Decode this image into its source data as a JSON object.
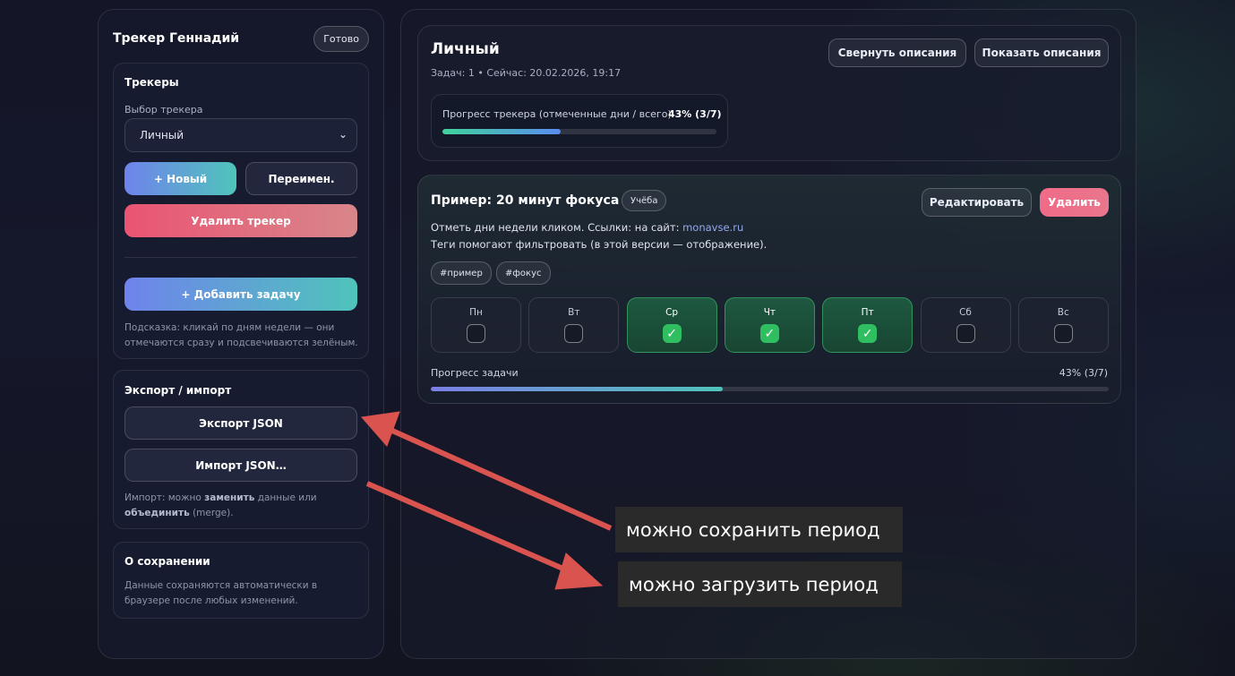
{
  "sidebar": {
    "title": "Трекер Геннадий",
    "done_label": "Готово",
    "trackers": {
      "title": "Трекеры",
      "select_label": "Выбор трекера",
      "selected": "Личный",
      "new_label": "+ Новый",
      "rename_label": "Переимен.",
      "delete_label": "Удалить трекер",
      "add_task_label": "+ Добавить задачу",
      "hint": "Подсказка: кликай по дням недели — они отмечаются сразу и подсвечиваются зелёным."
    },
    "export": {
      "title": "Экспорт / импорт",
      "export_label": "Экспорт JSON",
      "import_label": "Импорт JSON…",
      "hint_part1": "Импорт: можно ",
      "hint_bold1": "заменить",
      "hint_part2": " данные или ",
      "hint_bold2": "объединить",
      "hint_part3": " (merge)."
    },
    "saving": {
      "title": "О сохранении",
      "text": "Данные сохраняются автоматически в браузере после любых изменений."
    }
  },
  "main": {
    "header": {
      "title": "Личный",
      "meta": "Задач: 1 • Сейчас: 20.02.2026, 19:17",
      "collapse_label": "Свернуть описания",
      "show_label": "Показать описания",
      "progress_label": "Прогресс трекера (отмеченные дни / всего)",
      "progress_value": "43% (3/7)",
      "progress_fraction": 0.43
    },
    "task": {
      "title": "Пример: 20 минут фокуса",
      "category": "Учёба",
      "edit_label": "Редактировать",
      "delete_label": "Удалить",
      "desc_line1": "Отметь дни недели кликом. Ссылки: на сайт: ",
      "link": "monavse.ru",
      "desc_line2": "Теги помогают фильтровать (в этой версии — отображение).",
      "tags": [
        "#пример",
        "#фокус"
      ],
      "days": [
        {
          "name": "Пн",
          "checked": false
        },
        {
          "name": "Вт",
          "checked": false
        },
        {
          "name": "Ср",
          "checked": true
        },
        {
          "name": "Чт",
          "checked": true
        },
        {
          "name": "Пт",
          "checked": true
        },
        {
          "name": "Сб",
          "checked": false
        },
        {
          "name": "Вс",
          "checked": false
        }
      ],
      "check_mark": "✓",
      "progress_label": "Прогресс задачи",
      "progress_value": "43% (3/7)",
      "progress_fraction": 0.43
    }
  },
  "annotations": {
    "save_text": "можно сохранить период",
    "load_text": "можно загрузить период",
    "arrow_color": "#d9534f"
  },
  "colors": {
    "accent_gradient_start": "#6f83ec",
    "accent_gradient_end": "#4fc4bb",
    "danger": "#ea5473",
    "success": "#2fbf61"
  }
}
